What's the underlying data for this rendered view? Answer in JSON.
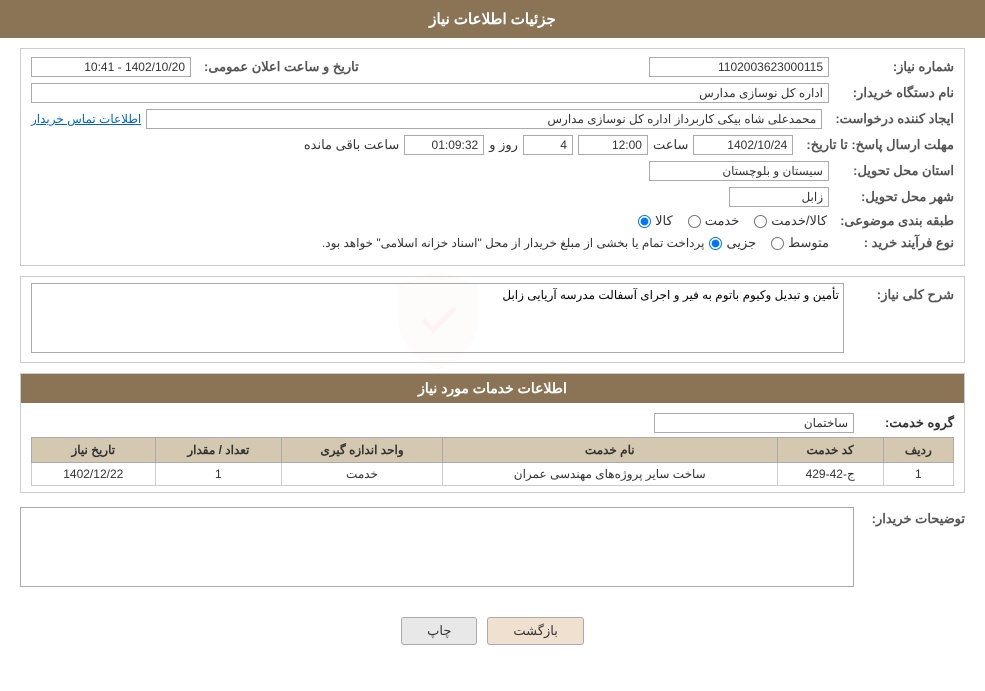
{
  "page": {
    "title": "جزئیات اطلاعات نیاز"
  },
  "header": {
    "title": "جزئیات اطلاعات نیاز"
  },
  "form": {
    "need_number_label": "شماره نیاز:",
    "need_number_value": "1102003623000115",
    "buyer_org_label": "نام دستگاه خریدار:",
    "buyer_org_value": "اداره کل نوسازی مدارس",
    "requester_label": "ایجاد کننده درخواست:",
    "requester_value": "محمدعلی شاه بیکی کاربرداز اداره کل نوسازی مدارس",
    "contact_link": "اطلاعات تماس خریدار",
    "announce_label": "تاریخ و ساعت اعلان عمومی:",
    "announce_value": "1402/10/20 - 10:41",
    "deadline_label": "مهلت ارسال پاسخ: تا تاریخ:",
    "deadline_date": "1402/10/24",
    "deadline_time_label": "ساعت",
    "deadline_time": "12:00",
    "remaining_label": "روز و",
    "remaining_days": "4",
    "remaining_time_label": "ساعت باقی مانده",
    "remaining_time": "01:09:32",
    "province_label": "استان محل تحویل:",
    "province_value": "سیستان و بلوچستان",
    "city_label": "شهر محل تحویل:",
    "city_value": "زابل",
    "category_label": "طبقه بندی موضوعی:",
    "category_options": [
      "کالا",
      "خدمت",
      "کالا/خدمت"
    ],
    "category_selected": "کالا",
    "process_label": "نوع فرآیند خرید :",
    "process_options": [
      "جزیی",
      "متوسط"
    ],
    "process_note": "پرداخت تمام یا بخشی از مبلغ خریدار از محل \"اسناد خزانه اسلامی\" خواهد بود.",
    "description_label": "شرح کلی نیاز:",
    "description_value": "تأمین و تبدیل وکیوم باتوم به فیر و اجرای آسفالت مدرسه آریایی زابل"
  },
  "services_section": {
    "title": "اطلاعات خدمات مورد نیاز",
    "group_label": "گروه خدمت:",
    "group_value": "ساختمان",
    "table": {
      "columns": [
        "ردیف",
        "کد خدمت",
        "نام خدمت",
        "واحد اندازه گیری",
        "تعداد / مقدار",
        "تاریخ نیاز"
      ],
      "rows": [
        {
          "row": "1",
          "code": "ج-42-429",
          "name": "ساخت سایر پروژه‌های مهندسی عمران",
          "unit": "خدمت",
          "quantity": "1",
          "date": "1402/12/22"
        }
      ]
    }
  },
  "buyer_notes_label": "توضیحات خریدار:",
  "buyer_notes_value": "",
  "buttons": {
    "print": "چاپ",
    "back": "بازگشت"
  }
}
